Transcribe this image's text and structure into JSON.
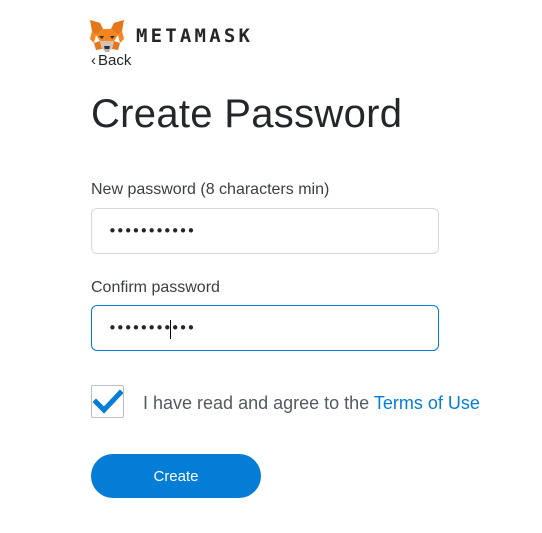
{
  "header": {
    "brand": "METAMASK",
    "logo_icon": "metamask-fox-icon",
    "back_label": "Back"
  },
  "page_title": "Create Password",
  "form": {
    "new_password": {
      "label": "New password (8 characters min)",
      "value": "•••••••••••",
      "type": "password"
    },
    "confirm_password": {
      "label": "Confirm password",
      "value": "•••••••••••",
      "type": "password",
      "focused": true
    },
    "terms": {
      "checked": true,
      "text": "I have read and agree to the ",
      "link_text": "Terms of Use"
    },
    "create_label": "Create"
  },
  "colors": {
    "accent": "#037dd6",
    "text": "#24272a",
    "border": "#d6d9dc"
  }
}
